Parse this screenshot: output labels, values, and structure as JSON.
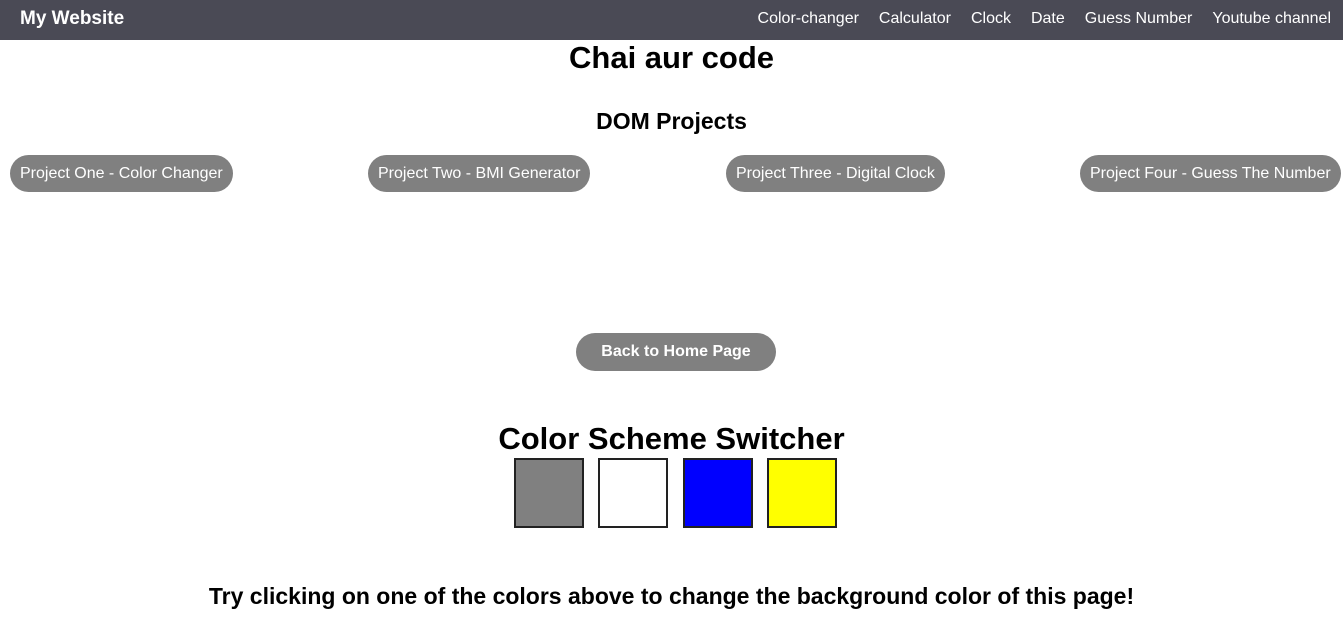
{
  "navbar": {
    "brand": "My Website",
    "links": [
      "Color-changer",
      "Calculator",
      "Clock",
      "Date",
      "Guess Number",
      "Youtube channel"
    ]
  },
  "main": {
    "title": "Chai aur code",
    "subtitle": "DOM Projects",
    "projects": [
      "Project One - Color Changer",
      "Project Two - BMI Generator",
      "Project Three - Digital Clock",
      "Project Four - Guess The Number"
    ],
    "home_button": "Back to Home Page"
  },
  "switcher": {
    "title": "Color Scheme Switcher",
    "swatches": [
      {
        "name": "grey",
        "color": "#808080"
      },
      {
        "name": "white",
        "color": "#ffffff"
      },
      {
        "name": "blue",
        "color": "#0000ff"
      },
      {
        "name": "yellow",
        "color": "#ffff00"
      }
    ],
    "hint": "Try clicking on one of the colors above to change the background color of this page!"
  }
}
